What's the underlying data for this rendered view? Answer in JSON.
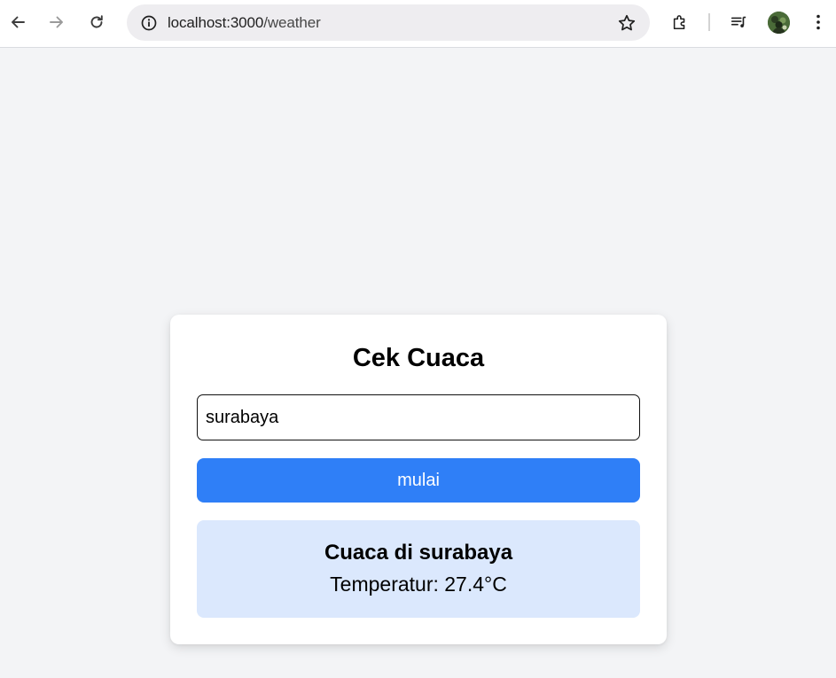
{
  "browser": {
    "url_host": "localhost:3000",
    "url_path": "/weather",
    "icons": [
      "back-icon",
      "forward-icon",
      "reload-icon",
      "site-info-icon",
      "bookmark-star-icon",
      "extensions-icon",
      "media-controls-icon",
      "profile-avatar",
      "more-menu-icon"
    ]
  },
  "app": {
    "title": "Cek Cuaca",
    "city_input_value": "surabaya",
    "submit_label": "mulai",
    "result_title": "Cuaca di surabaya",
    "result_temperature": "Temperatur: 27.4°C"
  },
  "colors": {
    "page_bg": "#f3f4f6",
    "button_bg": "#2f7ff7",
    "result_bg": "#dbe8fd"
  }
}
